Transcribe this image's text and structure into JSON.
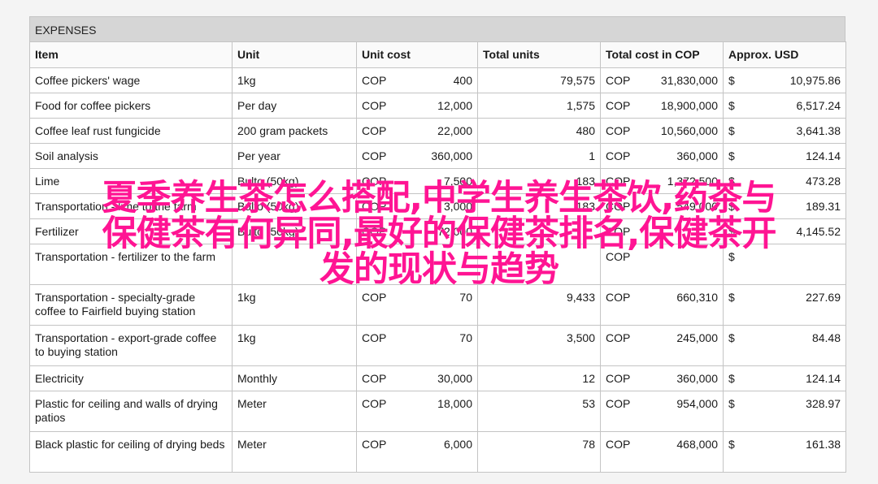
{
  "sheet": {
    "title": "EXPENSES"
  },
  "headers": [
    "Item",
    "Unit",
    "Unit cost",
    "Total units",
    "Total cost in COP",
    "Approx. USD"
  ],
  "rows": [
    {
      "item": "Coffee pickers' wage",
      "unit": "1kg",
      "cost_cur": "COP",
      "cost": "400",
      "units": "79,575",
      "total_cur": "COP",
      "total": "31,830,000",
      "usd_cur": "$",
      "usd": "10,975.86"
    },
    {
      "item": "Food for coffee pickers",
      "unit": "Per day",
      "cost_cur": "COP",
      "cost": "12,000",
      "units": "1,575",
      "total_cur": "COP",
      "total": "18,900,000",
      "usd_cur": "$",
      "usd": "6,517.24"
    },
    {
      "item": "Coffee leaf rust fungicide",
      "unit": "200 gram packets",
      "cost_cur": "COP",
      "cost": "22,000",
      "units": "480",
      "total_cur": "COP",
      "total": "10,560,000",
      "usd_cur": "$",
      "usd": "3,641.38"
    },
    {
      "item": "Soil analysis",
      "unit": "Per year",
      "cost_cur": "COP",
      "cost": "360,000",
      "units": "1",
      "total_cur": "COP",
      "total": "360,000",
      "usd_cur": "$",
      "usd": "124.14"
    },
    {
      "item": "Lime",
      "unit": "Bulto (50kg)",
      "cost_cur": "COP",
      "cost": "7,500",
      "units": "183",
      "total_cur": "COP",
      "total": "1,372,500",
      "usd_cur": "$",
      "usd": "473.28"
    },
    {
      "item": "Transportation - lime to the farm",
      "unit": "Bulto (50kg)",
      "cost_cur": "COP",
      "cost": "3,000",
      "units": "183",
      "total_cur": "COP",
      "total": "549,000",
      "usd_cur": "$",
      "usd": "189.31"
    },
    {
      "item": "Fertilizer",
      "unit": "Bulto (50kg)",
      "cost_cur": "COP",
      "cost": "72,000",
      "units": "",
      "total_cur": "COP",
      "total": "",
      "usd_cur": "$",
      "usd": "4,145.52"
    },
    {
      "item": "Transportation - fertilizer to the farm",
      "unit": "",
      "cost_cur": "",
      "cost": "",
      "units": "",
      "total_cur": "COP",
      "total": "",
      "usd_cur": "$",
      "usd": "",
      "tall": true
    },
    {
      "item": "Transportation - specialty-grade coffee to Fairfield buying station",
      "unit": "1kg",
      "cost_cur": "COP",
      "cost": "70",
      "units": "9,433",
      "total_cur": "COP",
      "total": "660,310",
      "usd_cur": "$",
      "usd": "227.69",
      "tall": true
    },
    {
      "item": "Transportation - export-grade coffee to buying station",
      "unit": "1kg",
      "cost_cur": "COP",
      "cost": "70",
      "units": "3,500",
      "total_cur": "COP",
      "total": "245,000",
      "usd_cur": "$",
      "usd": "84.48",
      "tall": true
    },
    {
      "item": "Electricity",
      "unit": "Monthly",
      "cost_cur": "COP",
      "cost": "30,000",
      "units": "12",
      "total_cur": "COP",
      "total": "360,000",
      "usd_cur": "$",
      "usd": "124.14"
    },
    {
      "item": "Plastic for ceiling and walls of drying patios",
      "unit": "Meter",
      "cost_cur": "COP",
      "cost": "18,000",
      "units": "53",
      "total_cur": "COP",
      "total": "954,000",
      "usd_cur": "$",
      "usd": "328.97",
      "tall": true
    },
    {
      "item": "Black plastic for ceiling of drying beds",
      "unit": "Meter",
      "cost_cur": "COP",
      "cost": "6,000",
      "units": "78",
      "total_cur": "COP",
      "total": "468,000",
      "usd_cur": "$",
      "usd": "161.38",
      "tall": true
    }
  ],
  "overlay": {
    "line1": "夏季养生茶怎么搭配,中学生养生茶饮,药茶与",
    "line2": "保健茶有何异同,最好的保健茶排名,保健茶开",
    "line3": "发的现状与趋势",
    "color": "#ff1493"
  }
}
